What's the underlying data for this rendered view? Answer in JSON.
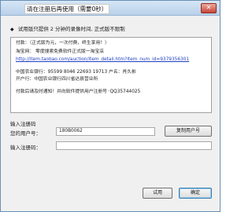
{
  "window": {
    "title": "请在注册后再使用（需要0秒）"
  },
  "notice": {
    "text": "试用版只提供 2 分钟的录像时间, 正式版不限制"
  },
  "info": {
    "line1": "付款：（正式版为元，一次付费，终生享用！）",
    "line2_label": "淘宝网：",
    "line2_text": "零度搜索免费软件正式版一淘宝店",
    "line3_url": "http://item.taobao.com/auction/item_detail.htm?item_num_id=9379356301",
    "line4": "中国农业银行：95599 8046 22693 19713 户名：肖久彬",
    "line5": "开户行：中国农业银行四川省达县营业所",
    "line6": "付款后请及时通知！并向软件提供用户注册号  ·QQ35744025"
  },
  "registration": {
    "section_label": "输入注册码",
    "user_no_label": "您的用户号：",
    "user_no_value": "180B0062",
    "reg_code_label": "输入注册码：",
    "reg_code_value": ""
  },
  "buttons": {
    "copy_user": "复制用户号",
    "trial": "试用",
    "ok": "确定"
  }
}
